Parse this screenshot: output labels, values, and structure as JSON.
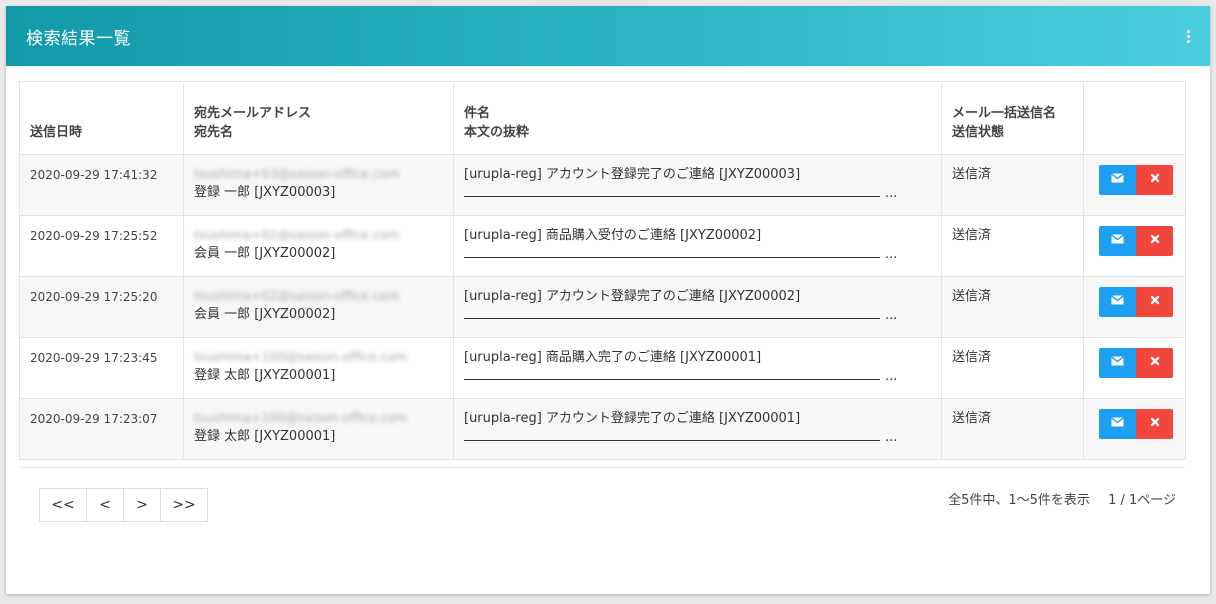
{
  "header": {
    "title": "検索結果一覧"
  },
  "table": {
    "headers": [
      {
        "line1": "送信日時",
        "line2": ""
      },
      {
        "line1": "宛先メールアドレス",
        "line2": "宛先名"
      },
      {
        "line1": "件名",
        "line2": "本文の抜粋"
      },
      {
        "line1": "メール一括送信名",
        "line2": "送信状態"
      },
      {
        "line1": "",
        "line2": ""
      }
    ],
    "rows": [
      {
        "date": "2020-09-29 17:41:32",
        "email": "tsushima+03@saison-office.com",
        "name": "登録 一郎 [JXYZ00003]",
        "subject": "[urupla-reg] アカウント登録完了のご連絡 [JXYZ00003]",
        "ellipsis": "...",
        "status": "送信済"
      },
      {
        "date": "2020-09-29 17:25:52",
        "email": "tsushima+02@saison-office.com",
        "name": "会員 一郎 [JXYZ00002]",
        "subject": "[urupla-reg] 商品購入受付のご連絡 [JXYZ00002]",
        "ellipsis": "...",
        "status": "送信済"
      },
      {
        "date": "2020-09-29 17:25:20",
        "email": "tsushima+02@saison-office.com",
        "name": "会員 一郎 [JXYZ00002]",
        "subject": "[urupla-reg] アカウント登録完了のご連絡 [JXYZ00002]",
        "ellipsis": "...",
        "status": "送信済"
      },
      {
        "date": "2020-09-29 17:23:45",
        "email": "tsushima+100@saison-office.com",
        "name": "登録 太郎 [JXYZ00001]",
        "subject": "[urupla-reg] 商品購入完了のご連絡 [JXYZ00001]",
        "ellipsis": "...",
        "status": "送信済"
      },
      {
        "date": "2020-09-29 17:23:07",
        "email": "tsushima+100@saison-office.com",
        "name": "登録 太郎 [JXYZ00001]",
        "subject": "[urupla-reg] アカウント登録完了のご連絡 [JXYZ00001]",
        "ellipsis": "...",
        "status": "送信済"
      }
    ]
  },
  "pagination": {
    "first": "<<",
    "prev": "<",
    "next": ">",
    "last": ">>",
    "summary": "全5件中、1〜5件を表示",
    "page_info": "1 / 1ページ"
  },
  "colors": {
    "header_start": "#129aa8",
    "header_end": "#4bcfe0",
    "mail_button": "#1ea0f2",
    "delete_button": "#f0463c"
  },
  "icons": {
    "menu": "kebab-icon",
    "mail": "envelope-icon",
    "delete": "close-icon"
  }
}
